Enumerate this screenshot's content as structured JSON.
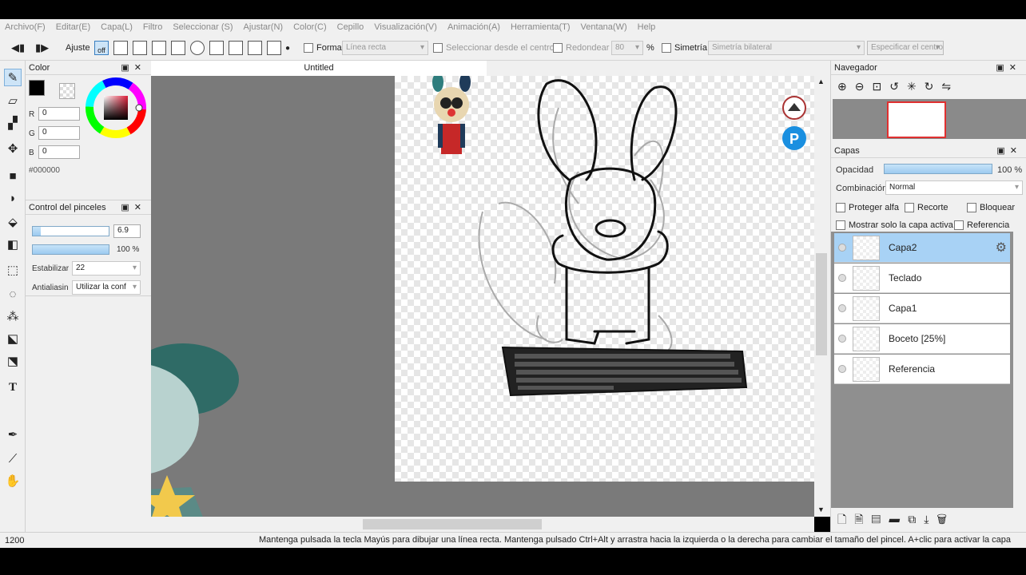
{
  "menu": [
    "Archivo(F)",
    "Editar(E)",
    "Capa(L)",
    "Filtro",
    "Seleccionar (S)",
    "Ajustar(N)",
    "Color(C)",
    "Cepillo",
    "Visualización(V)",
    "Animación(A)",
    "Herramienta(T)",
    "Ventana(W)",
    "Help"
  ],
  "toolbar": {
    "ajuste_label": "Ajuste",
    "off_label": "off",
    "forma_label": "Forma",
    "forma_value": "Línea recta",
    "select_center_label": "Seleccionar desde el centro",
    "round_label": "Redondear",
    "round_value": "80",
    "percent": "%",
    "symmetry_label": "Simetría",
    "symmetry_value": "Simetría bilateral",
    "specify_center_label": "Especificar el centro"
  },
  "color_panel": {
    "title": "Color",
    "r_label": "R",
    "r_value": "0",
    "g_label": "G",
    "g_value": "0",
    "b_label": "B",
    "b_value": "0",
    "hex": "#000000",
    "primary_color": "#000000"
  },
  "brush_panel": {
    "title": "Control del pinceles",
    "size_value": "6.9",
    "size_fraction": 0.1,
    "opacity_value": "100 %",
    "opacity_fraction": 1.0,
    "stabilizer_label": "Estabilizar",
    "stabilizer_value": "22",
    "antialias_label": "Antialiasin",
    "antialias_value": "Utilizar la conf"
  },
  "document": {
    "tab_title": "Untitled"
  },
  "navigator": {
    "title": "Navegador"
  },
  "layers_panel": {
    "title": "Capas",
    "opacity_label": "Opacidad",
    "opacity_value": "100 %",
    "blend_label": "Combinación",
    "blend_value": "Normal",
    "protect_alpha": "Proteger alfa",
    "clip": "Recorte",
    "lock": "Bloquear",
    "show_active_only": "Mostrar solo la capa activa",
    "reference": "Referencia",
    "layers": [
      {
        "name": "Capa2",
        "selected": true
      },
      {
        "name": "Teclado",
        "selected": false
      },
      {
        "name": "Capa1",
        "selected": false
      },
      {
        "name": "Boceto [25%]",
        "selected": false
      },
      {
        "name": "Referencia",
        "selected": false
      }
    ]
  },
  "status_bar": {
    "zoom": "1200",
    "hint": "Mantenga pulsada la tecla Mayús para dibujar una línea recta. Mantenga pulsado Ctrl+Alt y arrastra hacia la izquierda o la derecha para cambiar el tamaño del pincel. A+clic para activar la capa"
  }
}
